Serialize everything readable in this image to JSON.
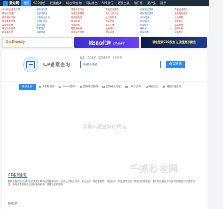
{
  "nav": {
    "logo_text": "爱站网",
    "items": [
      "首页",
      "SEO综合",
      "权重查询",
      "域名/IP查询",
      "网站排名",
      "APP排行",
      "更多工具",
      "排行榜",
      "爱产品",
      "测评"
    ]
  },
  "ad_links": [
    "SEO综合查询工具",
    "刷排名站群",
    "域名交易平台",
    "网站建设服务",
    "代写软文发布",
    "外链资源购买",
    "网站优化推广",
    "关键词排名",
    "百度快照更新",
    "站长工具大全",
    "网站权重查询",
    "友情链接交换",
    "程序源码下载",
    "手机站点优化",
    "服务器租用",
    "云主机特惠",
    "CDN加速",
    "企业邮箱",
    "网站备案查询",
    "ICP许可证",
    "软文营销",
    "整站优化",
    "SEO培训",
    "百度推广",
    "高防服务器",
    "香港主机",
    "美国空间",
    "域名注册",
    "SSL证书",
    "建站模板",
    "网站收录查询",
    "外贸推广",
    "短视频营销",
    "品牌推广",
    "蜘蛛池",
    "快排系统",
    "新闻源发布",
    "口碑营销",
    "自媒体代运营",
    "舆情监测",
    "网站诊断",
    "流量统计"
  ],
  "banners": {
    "left": "GoDaddy",
    "middle": "招SEO代理",
    "middle_sub": "火热招募中",
    "right": "精准搜索SEO服务 让流量增长翻倍"
  },
  "search": {
    "title": "ICP备案查询",
    "tabs": [
      "域名",
      "主办单位",
      "网站备案号",
      "许可证号"
    ],
    "placeholder": "请输入域名",
    "button": "备案查询"
  },
  "tool_tabs": [
    "备案查询",
    "手机版查询",
    "Whois查询",
    "过期域名查询",
    "过期域名抢注",
    "一口价查询",
    "域名历史",
    "域名价格查询"
  ],
  "results": {
    "empty_hint": "请输入要查询的网站"
  },
  "info": {
    "title": "ICP备案查询",
    "text": "备案查询功能可以帮助您快速了解网站的备案情况，包括主办单位名称、单位性质、网站备案号、网站名称、网站首页地址、审核时间等信息。输入网站域名即可查询该网站的ICP备案信息，查询结果来源于工信部备案系统，数据会定期更新。",
    "sub": "查询工具"
  },
  "watermark": "千抓秒收网",
  "colors": {
    "nav_bg": "#1f2d3d",
    "accent": "#2d8cf0"
  }
}
